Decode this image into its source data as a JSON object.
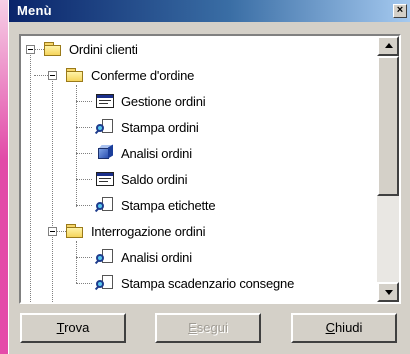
{
  "window": {
    "title": "Menù"
  },
  "tree": {
    "root": "Ordini clienti",
    "group1": {
      "label": "Conferme d'ordine",
      "items": [
        {
          "label": "Gestione ordini",
          "icon": "window-icon"
        },
        {
          "label": "Stampa ordini",
          "icon": "report-icon"
        },
        {
          "label": "Analisi ordini",
          "icon": "cube-icon"
        },
        {
          "label": "Saldo ordini",
          "icon": "window-icon"
        },
        {
          "label": "Stampa etichette",
          "icon": "report-icon"
        }
      ]
    },
    "group2": {
      "label": "Interrogazione ordini",
      "items": [
        {
          "label": "Analisi ordini",
          "icon": "report-icon"
        },
        {
          "label": "Stampa scadenzario consegne",
          "icon": "report-icon"
        }
      ]
    }
  },
  "buttons": {
    "trova_first": "T",
    "trova_rest": "rova",
    "esegui_first": "E",
    "esegui_rest": "segui",
    "chiudi_first": "C",
    "chiudi_rest": "hiudi"
  },
  "colors": {
    "titlebar_start": "#0a246a",
    "titlebar_end": "#a6caf0",
    "background_accent": "#e24aa8"
  }
}
